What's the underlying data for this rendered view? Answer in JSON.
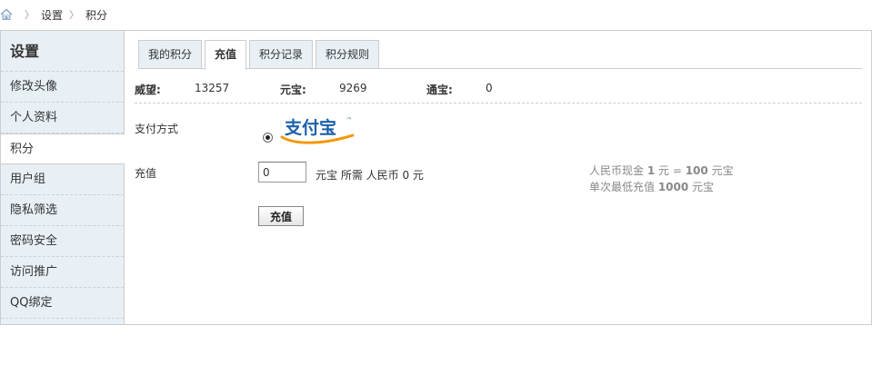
{
  "breadcrumb": {
    "items": [
      "设置",
      "积分"
    ]
  },
  "sidebar": {
    "title": "设置",
    "items": [
      {
        "label": "修改头像"
      },
      {
        "label": "个人资料"
      },
      {
        "label": "积分",
        "active": true
      },
      {
        "label": "用户组"
      },
      {
        "label": "隐私筛选"
      },
      {
        "label": "密码安全"
      },
      {
        "label": "访问推广"
      },
      {
        "label": "QQ绑定"
      }
    ]
  },
  "tabs": [
    {
      "label": "我的积分"
    },
    {
      "label": "充值",
      "active": true
    },
    {
      "label": "积分记录"
    },
    {
      "label": "积分规则"
    }
  ],
  "stats": [
    {
      "label": "威望:",
      "value": "13257"
    },
    {
      "label": "元宝:",
      "value": "9269"
    },
    {
      "label": "通宝:",
      "value": "0"
    }
  ],
  "payment": {
    "label": "支付方式",
    "method_logo_text": "支付宝",
    "selected": true
  },
  "recharge": {
    "label": "充值",
    "input_value": "0",
    "desc_prefix": "元宝  所需 人民币 ",
    "rmb_amount": "0",
    "desc_suffix": " 元",
    "button_label": "充值"
  },
  "info": {
    "line1_prefix": "人民币现金 ",
    "line1_rmb": "1",
    "line1_mid": " 元 = ",
    "line1_amount": "100",
    "line1_suffix": " 元宝",
    "line2_prefix": "单次最低充值 ",
    "line2_amount": "1000",
    "line2_suffix": " 元宝"
  },
  "colors": {
    "sidebar_bg": "#e8eff5",
    "border": "#cdcdcd",
    "alipay_blue": "#1a5fab",
    "alipay_orange": "#f39800"
  }
}
